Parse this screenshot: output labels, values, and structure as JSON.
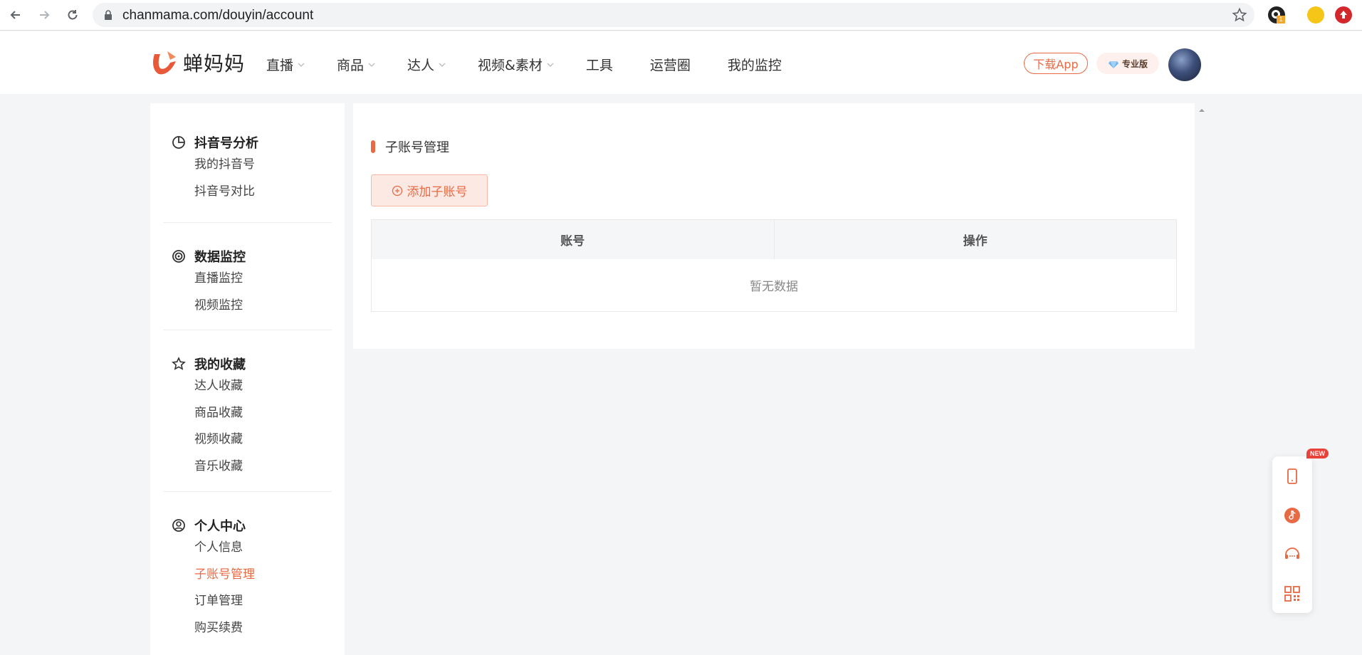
{
  "browser": {
    "url": "chanmama.com/douyin/account",
    "extension_badge": "1"
  },
  "header": {
    "logo_text": "蝉妈妈",
    "nav": [
      {
        "label": "直播",
        "has_dropdown": true
      },
      {
        "label": "商品",
        "has_dropdown": true
      },
      {
        "label": "达人",
        "has_dropdown": true
      },
      {
        "label": "视频&素材",
        "has_dropdown": true
      },
      {
        "label": "工具",
        "has_dropdown": false
      },
      {
        "label": "运营圈",
        "has_dropdown": false
      },
      {
        "label": "我的监控",
        "has_dropdown": false
      }
    ],
    "download_label": "下载App",
    "pro_label": "专业版"
  },
  "sidebar": {
    "groups": [
      {
        "title": "抖音号分析",
        "icon": "pie-chart-icon",
        "items": [
          "我的抖音号",
          "抖音号对比"
        ]
      },
      {
        "title": "数据监控",
        "icon": "radar-icon",
        "items": [
          "直播监控",
          "视频监控"
        ]
      },
      {
        "title": "我的收藏",
        "icon": "star-icon",
        "items": [
          "达人收藏",
          "商品收藏",
          "视频收藏",
          "音乐收藏"
        ]
      },
      {
        "title": "个人中心",
        "icon": "user-circle-icon",
        "items": [
          "个人信息",
          "子账号管理",
          "订单管理",
          "购买续费"
        ]
      }
    ],
    "active_item": "子账号管理"
  },
  "main": {
    "section_title": "子账号管理",
    "add_button": "添加子账号",
    "table": {
      "columns": [
        "账号",
        "操作"
      ],
      "empty_text": "暂无数据"
    }
  },
  "float_bar": {
    "new_badge": "NEW",
    "items": [
      "phone-icon",
      "music-note-icon",
      "customer-service-icon",
      "qr-code-icon"
    ]
  },
  "colors": {
    "accent": "#e86a45",
    "page_bg": "#f4f5f7"
  }
}
